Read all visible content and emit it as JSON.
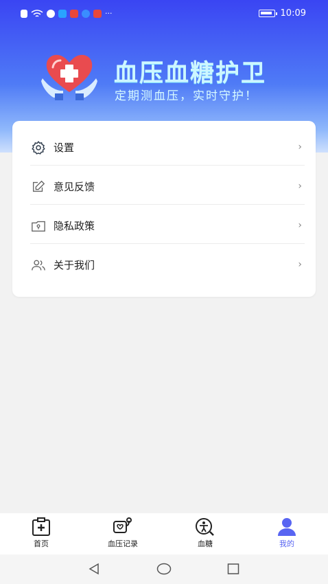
{
  "status_bar": {
    "time": "10:09",
    "left_icons": [
      "sim-alert-icon",
      "wifi-icon",
      "app-icon-1",
      "app-icon-2",
      "app-icon-3",
      "app-icon-4",
      "app-icon-5"
    ],
    "more": "···"
  },
  "brand": {
    "title": "血压血糖护卫",
    "subtitle": "定期测血压，实时守护！"
  },
  "menu": {
    "items": [
      {
        "label": "设置",
        "icon": "gear-icon"
      },
      {
        "label": "意见反馈",
        "icon": "edit-icon"
      },
      {
        "label": "隐私政策",
        "icon": "lock-folder-icon"
      },
      {
        "label": "关于我们",
        "icon": "users-icon"
      }
    ],
    "chevron": "›"
  },
  "tabs": [
    {
      "label": "首页",
      "icon": "clipboard-cross-icon"
    },
    {
      "label": "血压记录",
      "icon": "blood-pressure-icon"
    },
    {
      "label": "血糖",
      "icon": "glucose-icon"
    },
    {
      "label": "我的",
      "icon": "person-icon",
      "active": true
    }
  ],
  "colors": {
    "accent": "#5865f2",
    "hero_top": "#3a45f3",
    "brand_text": "#cdf6ff"
  }
}
